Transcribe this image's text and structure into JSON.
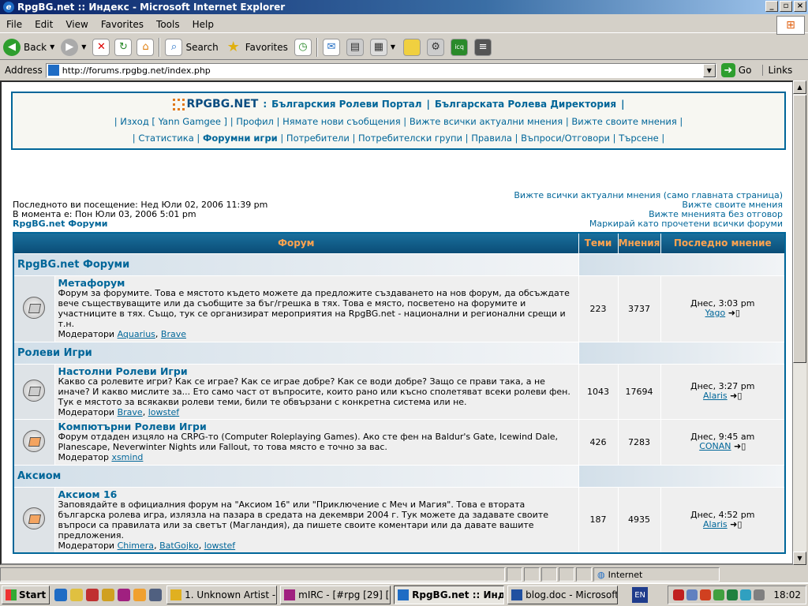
{
  "window": {
    "title": "RpgBG.net :: Индекс - Microsoft Internet Explorer"
  },
  "menu": [
    "File",
    "Edit",
    "View",
    "Favorites",
    "Tools",
    "Help"
  ],
  "toolbar": {
    "back": "Back",
    "search": "Search",
    "favorites": "Favorites"
  },
  "address": {
    "label": "Address",
    "url": "http://forums.rpgbg.net/index.php",
    "go": "Go",
    "links": "Links"
  },
  "header": {
    "logo": "RPGBG.NET",
    "row1_sep": ":",
    "portal": "Българския Ролеви Портал",
    "directory": "Българската Ролева Директория",
    "row2": [
      "Изход [ Yann Gamgee ]",
      "Профил",
      "Нямате нови съобщения",
      "Вижте всички актуални мнения",
      "Вижте своите мнения"
    ],
    "row3": [
      "Статистика",
      "Форумни игри",
      "Потребители",
      "Потребителски групи",
      "Правила",
      "Въпроси/Отговори",
      "Търсене"
    ]
  },
  "info": {
    "last_visit": "Последното ви посещение: Нед Юли 02, 2006 11:39 pm",
    "now": "В момента е: Пон Юли 03, 2006 5:01 pm",
    "index_title": "RpgBG.net Форуми",
    "links": [
      "Вижте всички актуални мнения (само главната страница)",
      "Вижте своите мнения",
      "Вижте мненията без отговор",
      "Маркирай като прочетени всички форуми"
    ]
  },
  "table": {
    "headers": [
      "Форум",
      "Теми",
      "Мнения",
      "Последно мнение"
    ],
    "categories": [
      {
        "name": "RpgBG.net Форуми",
        "forums": [
          {
            "name": "Метафорум",
            "desc": "Форум за форумите. Това е мястото където можете да предложите създаването на нов форум, да обсъждате вече съществуващите или да съобщите за бъг/грешка в тях. Това е място, посветено на форумите и участниците в тях. Също, тук се организират мероприятия на RpgBG.net - национални и регионални срещи и т.н.",
            "mod_label": "Модератори",
            "mods": [
              "Aquarius",
              "Brave"
            ],
            "topics": "223",
            "posts": "3737",
            "last_time": "Днес, 3:03 pm",
            "last_user": "Yago",
            "new": false
          }
        ]
      },
      {
        "name": "Ролеви Игри",
        "forums": [
          {
            "name": "Настолни Ролеви Игри",
            "desc": "Какво са ролевите игри? Как се играе? Как се играе добре? Как се води добре? Защо се прави така, а не иначе? И какво мислите за... Ето само част от въпросите, които рано или късно сполетяват всеки ролеви фен. Тук е мястото за всякакви ролеви теми, били те обвързани с конкретна система или не.",
            "mod_label": "Модератори",
            "mods": [
              "Brave",
              "lowstef"
            ],
            "topics": "1043",
            "posts": "17694",
            "last_time": "Днес, 3:27 pm",
            "last_user": "Alaris",
            "new": false
          },
          {
            "name": "Компютърни Ролеви Игри",
            "desc": "Форум отдаден изцяло на CRPG-то (Computer Roleplaying Games). Ако сте фен на Baldur's Gate, Icewind Dale, Planescape, Neverwinter Nights или Fallout, то това място е точно за вас.",
            "mod_label": "Модератор",
            "mods": [
              "xsmind"
            ],
            "topics": "426",
            "posts": "7283",
            "last_time": "Днес, 9:45 am",
            "last_user": "CONAN",
            "new": true
          }
        ]
      },
      {
        "name": "Аксиом",
        "forums": [
          {
            "name": "Аксиом 16",
            "desc": "Заповядайте в официалния форум на \"Аксиом 16\" или \"Приключение с Меч и Магия\". Това е втората българска ролева игра, излязла на пазара в средата на декември 2004 г. Тук можете да задавате своите въпроси са правилата или за светът (Магландия), да пишете своите коментари или да давате вашите предложения.",
            "mod_label": "Модератори",
            "mods": [
              "Chimera",
              "BatGojko",
              "lowstef"
            ],
            "topics": "187",
            "posts": "4935",
            "last_time": "Днес, 4:52 pm",
            "last_user": "Alaris",
            "new": true
          }
        ]
      }
    ]
  },
  "status": {
    "zone": "Internet"
  },
  "taskbar": {
    "start": "Start",
    "tasks": [
      "1. Unknown Artist - T...",
      "mIRC - [#rpg [29] [+...",
      "RpgBG.net :: Инде...",
      "blog.doc - Microsoft ..."
    ],
    "lang": "EN",
    "clock": "18:02"
  }
}
